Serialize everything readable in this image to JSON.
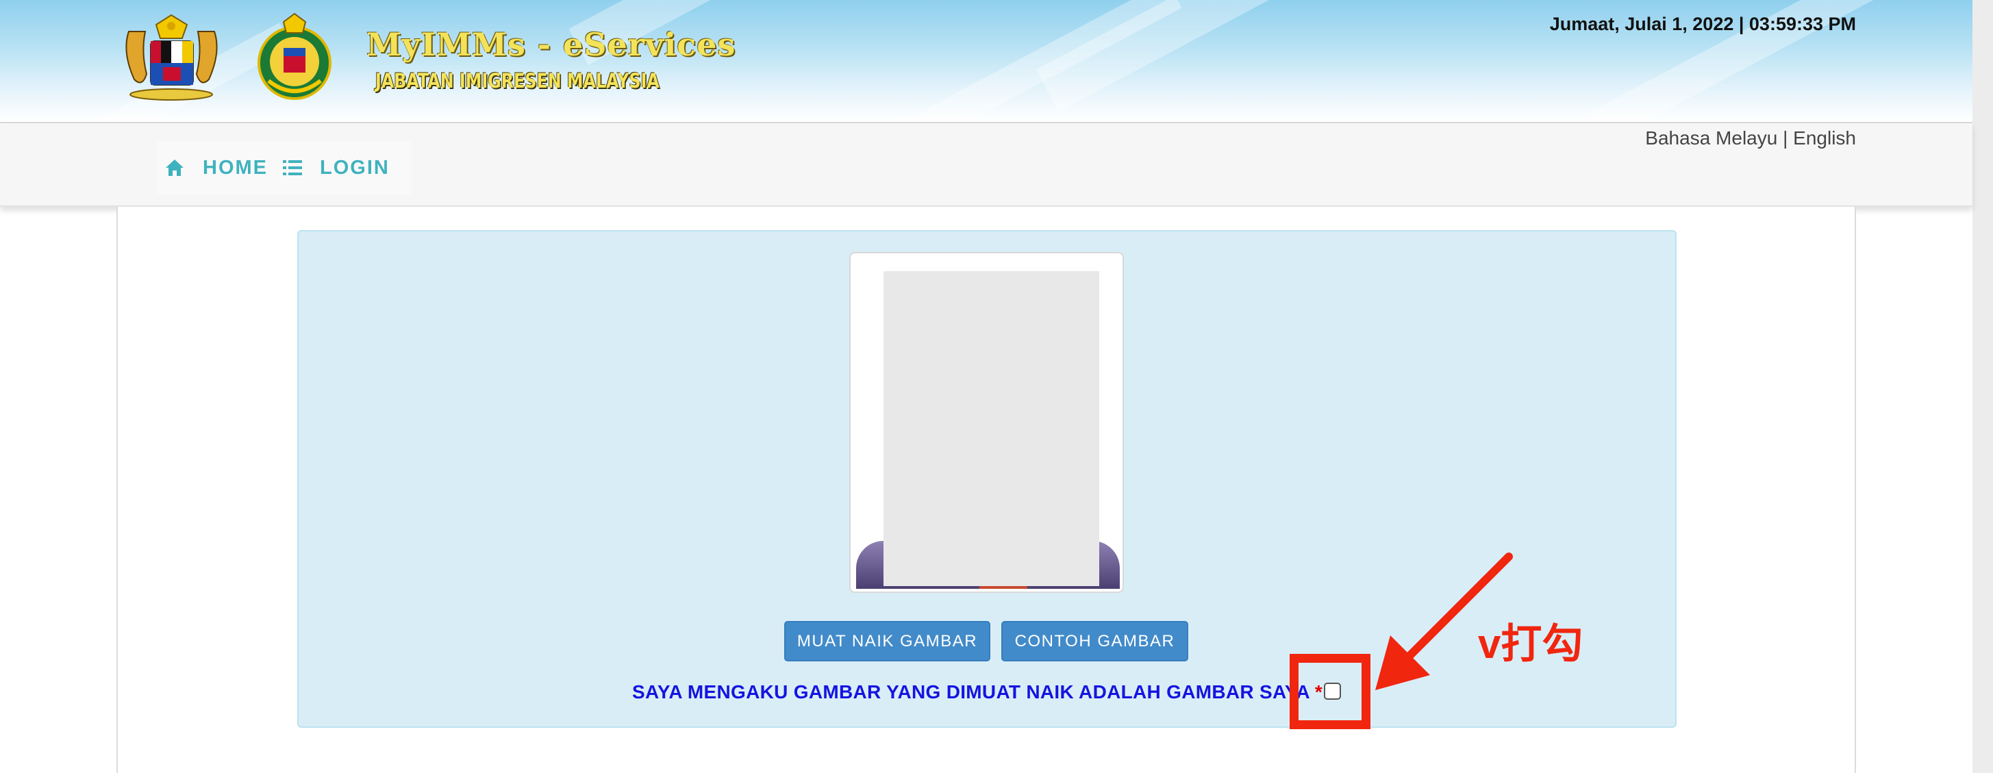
{
  "header": {
    "brand_title": "MyIMMs - eServices",
    "brand_subtitle": "JABATAN IMIGRESEN MALAYSIA",
    "datetime": "Jumaat, Julai 1, 2022 | 03:59:33 PM"
  },
  "nav": {
    "home_label": "HOME",
    "login_label": "LOGIN",
    "home_icon": "home-icon",
    "login_icon": "list-icon"
  },
  "language": {
    "malay": "Bahasa Melayu",
    "separator": "|",
    "english": "English"
  },
  "upload": {
    "upload_button": "MUAT NAIK GAMBAR",
    "sample_button": "CONTOH GAMBAR",
    "consent_text": "SAYA MENGAKU GAMBAR YANG DIMUAT NAIK ADALAH GAMBAR SAYA",
    "required_mark": "*",
    "consent_checked": false
  },
  "annotation": {
    "note": "v打勾",
    "color": "#f0260f"
  },
  "colors": {
    "nav_accent": "#3fb2bf",
    "button": "#428bca",
    "panel_bg": "#d9edf7",
    "consent_text": "#1414e0"
  }
}
